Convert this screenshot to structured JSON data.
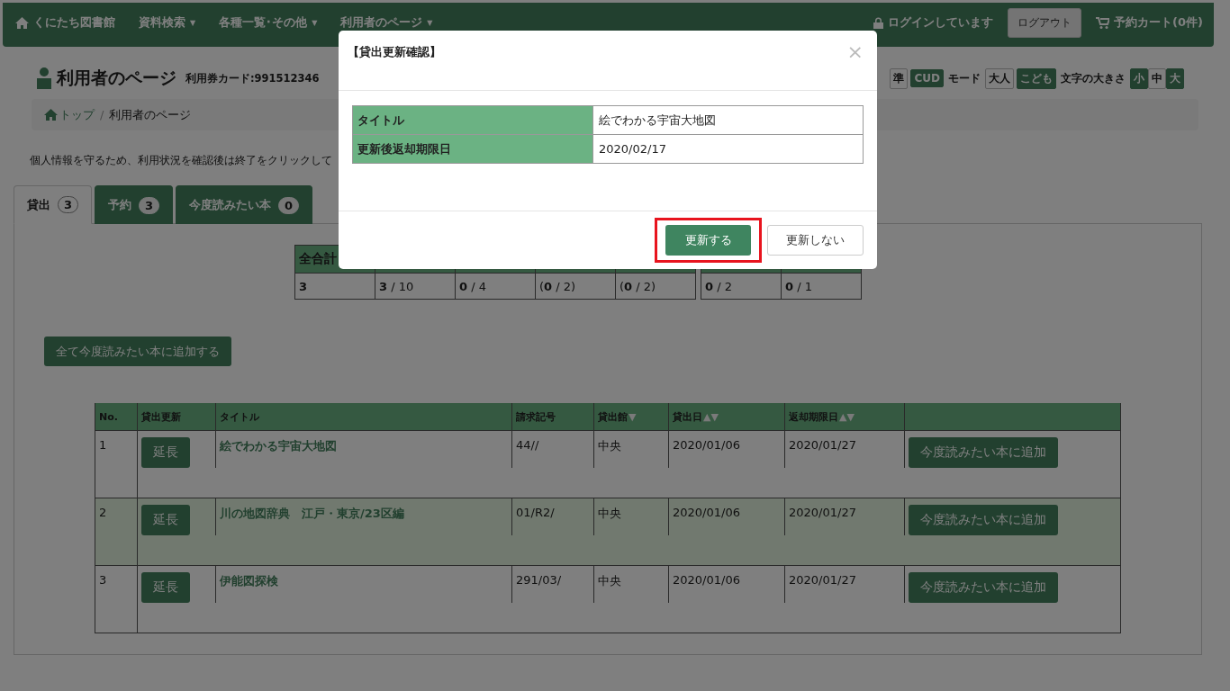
{
  "navbar": {
    "brand": "くにたち図書館",
    "menus": [
      {
        "label": "資料検索",
        "caret": "▼"
      },
      {
        "label": "各種一覧･その他",
        "caret": "▼"
      },
      {
        "label": "利用者のページ",
        "caret": "▼"
      }
    ],
    "login_status": "ログインしています",
    "logout": "ログアウト",
    "cart": "予約カート(0件)"
  },
  "page_header": {
    "title": "利用者のページ",
    "card": "利用券カード:991512346"
  },
  "display_options": {
    "color_buttons": [
      {
        "label": "準",
        "selected": true
      },
      {
        "label": "CUD",
        "selected": false
      }
    ],
    "mode_label": "モード",
    "mode_buttons": [
      {
        "label": "大人",
        "selected": true
      },
      {
        "label": "こども",
        "selected": false
      }
    ],
    "size_label": "文字の大きさ",
    "size_buttons": [
      {
        "label": "小",
        "selected": false
      },
      {
        "label": "中",
        "selected": true
      },
      {
        "label": "大",
        "selected": false
      }
    ]
  },
  "breadcrumb": {
    "items": [
      {
        "label": "トップ"
      },
      {
        "label": "利用者のページ"
      }
    ],
    "separator": "/"
  },
  "notice": "個人情報を守るため、利用状況を確認後は終了をクリックして",
  "tabs": [
    {
      "label": "貸出",
      "count": "3",
      "selected": true
    },
    {
      "label": "予約",
      "count": "3",
      "selected": false
    },
    {
      "label": "今度読みたい本",
      "count": "0",
      "selected": false
    }
  ],
  "stats": {
    "header": "全合計",
    "group_1": [
      "3",
      "**3** / 10",
      "**0** / 4",
      "(**0** / 2)",
      "(**0** / 2)"
    ],
    "group_2": [
      "**0** / 2",
      "**0** / 1"
    ]
  },
  "add_all_button": "全て今度読みたい本に追加する",
  "loan_table": {
    "columns": [
      {
        "label": "No."
      },
      {
        "label": "貸出更新"
      },
      {
        "label": "タイトル"
      },
      {
        "label": "請求記号"
      },
      {
        "label": "貸出館",
        "sort_marks": "▼"
      },
      {
        "label": "貸出日",
        "sort_marks": "▲▼"
      },
      {
        "label": "返却期限日",
        "sort_marks": "▲▼"
      }
    ],
    "rows": [
      {
        "no": "1",
        "renew": "延長",
        "title": "絵でわかる宇宙大地図",
        "call_number": "44//",
        "library": "中央",
        "loan_date": "2020/01/06",
        "due_date": "2020/01/27",
        "action": "今度読みたい本に追加",
        "highlighted": false
      },
      {
        "no": "2",
        "renew": "延長",
        "title": "川の地図辞典　江戸・東京/23区編",
        "call_number": "01/R2/",
        "library": "中央",
        "loan_date": "2020/01/06",
        "due_date": "2020/01/27",
        "action": "今度読みたい本に追加",
        "highlighted": true
      },
      {
        "no": "3",
        "renew": "延長",
        "title": "伊能図探検",
        "call_number": "291/03/",
        "library": "中央",
        "loan_date": "2020/01/06",
        "due_date": "2020/01/27",
        "action": "今度読みたい本に追加",
        "highlighted": false
      }
    ]
  },
  "dialog": {
    "title": "【貸出更新確認】",
    "close": "×",
    "fields": [
      {
        "label": "タイトル",
        "value": "絵でわかる宇宙大地図"
      },
      {
        "label": "更新後返却期限日",
        "value": "2020/02/17"
      }
    ],
    "confirm": "更新する",
    "cancel": "更新しない",
    "confirm_highlighted": true
  }
}
